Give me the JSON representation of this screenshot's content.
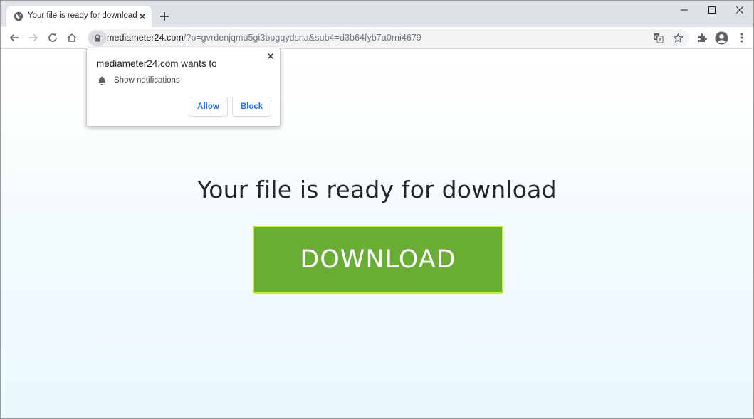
{
  "browser": {
    "tab_title": "Your file is ready for download",
    "url_host": "mediameter24.com",
    "url_rest": "/?p=gvrdenjqmu5gi3bpgqydsna&sub4=d3b64fyb7a0rni4679"
  },
  "popup": {
    "title": "mediameter24.com wants to",
    "permission": "Show notifications",
    "allow_label": "Allow",
    "block_label": "Block"
  },
  "page": {
    "headline": "Your file is ready for download",
    "download_label": "DOWNLOAD"
  },
  "colors": {
    "download_bg": "#6aad35",
    "download_border": "#c9e84a",
    "link_blue": "#1a73e8"
  },
  "icons": {
    "tab_favicon": "globe-icon",
    "tab_close": "close-icon",
    "new_tab": "plus-icon",
    "back": "back-arrow-icon",
    "forward": "forward-arrow-icon",
    "reload": "reload-icon",
    "home": "home-icon",
    "lock": "lock-icon",
    "translate": "translate-icon",
    "bookmark": "star-icon",
    "extensions": "puzzle-icon",
    "profile": "account-icon",
    "menu": "kebab-menu-icon",
    "bell": "bell-icon"
  }
}
